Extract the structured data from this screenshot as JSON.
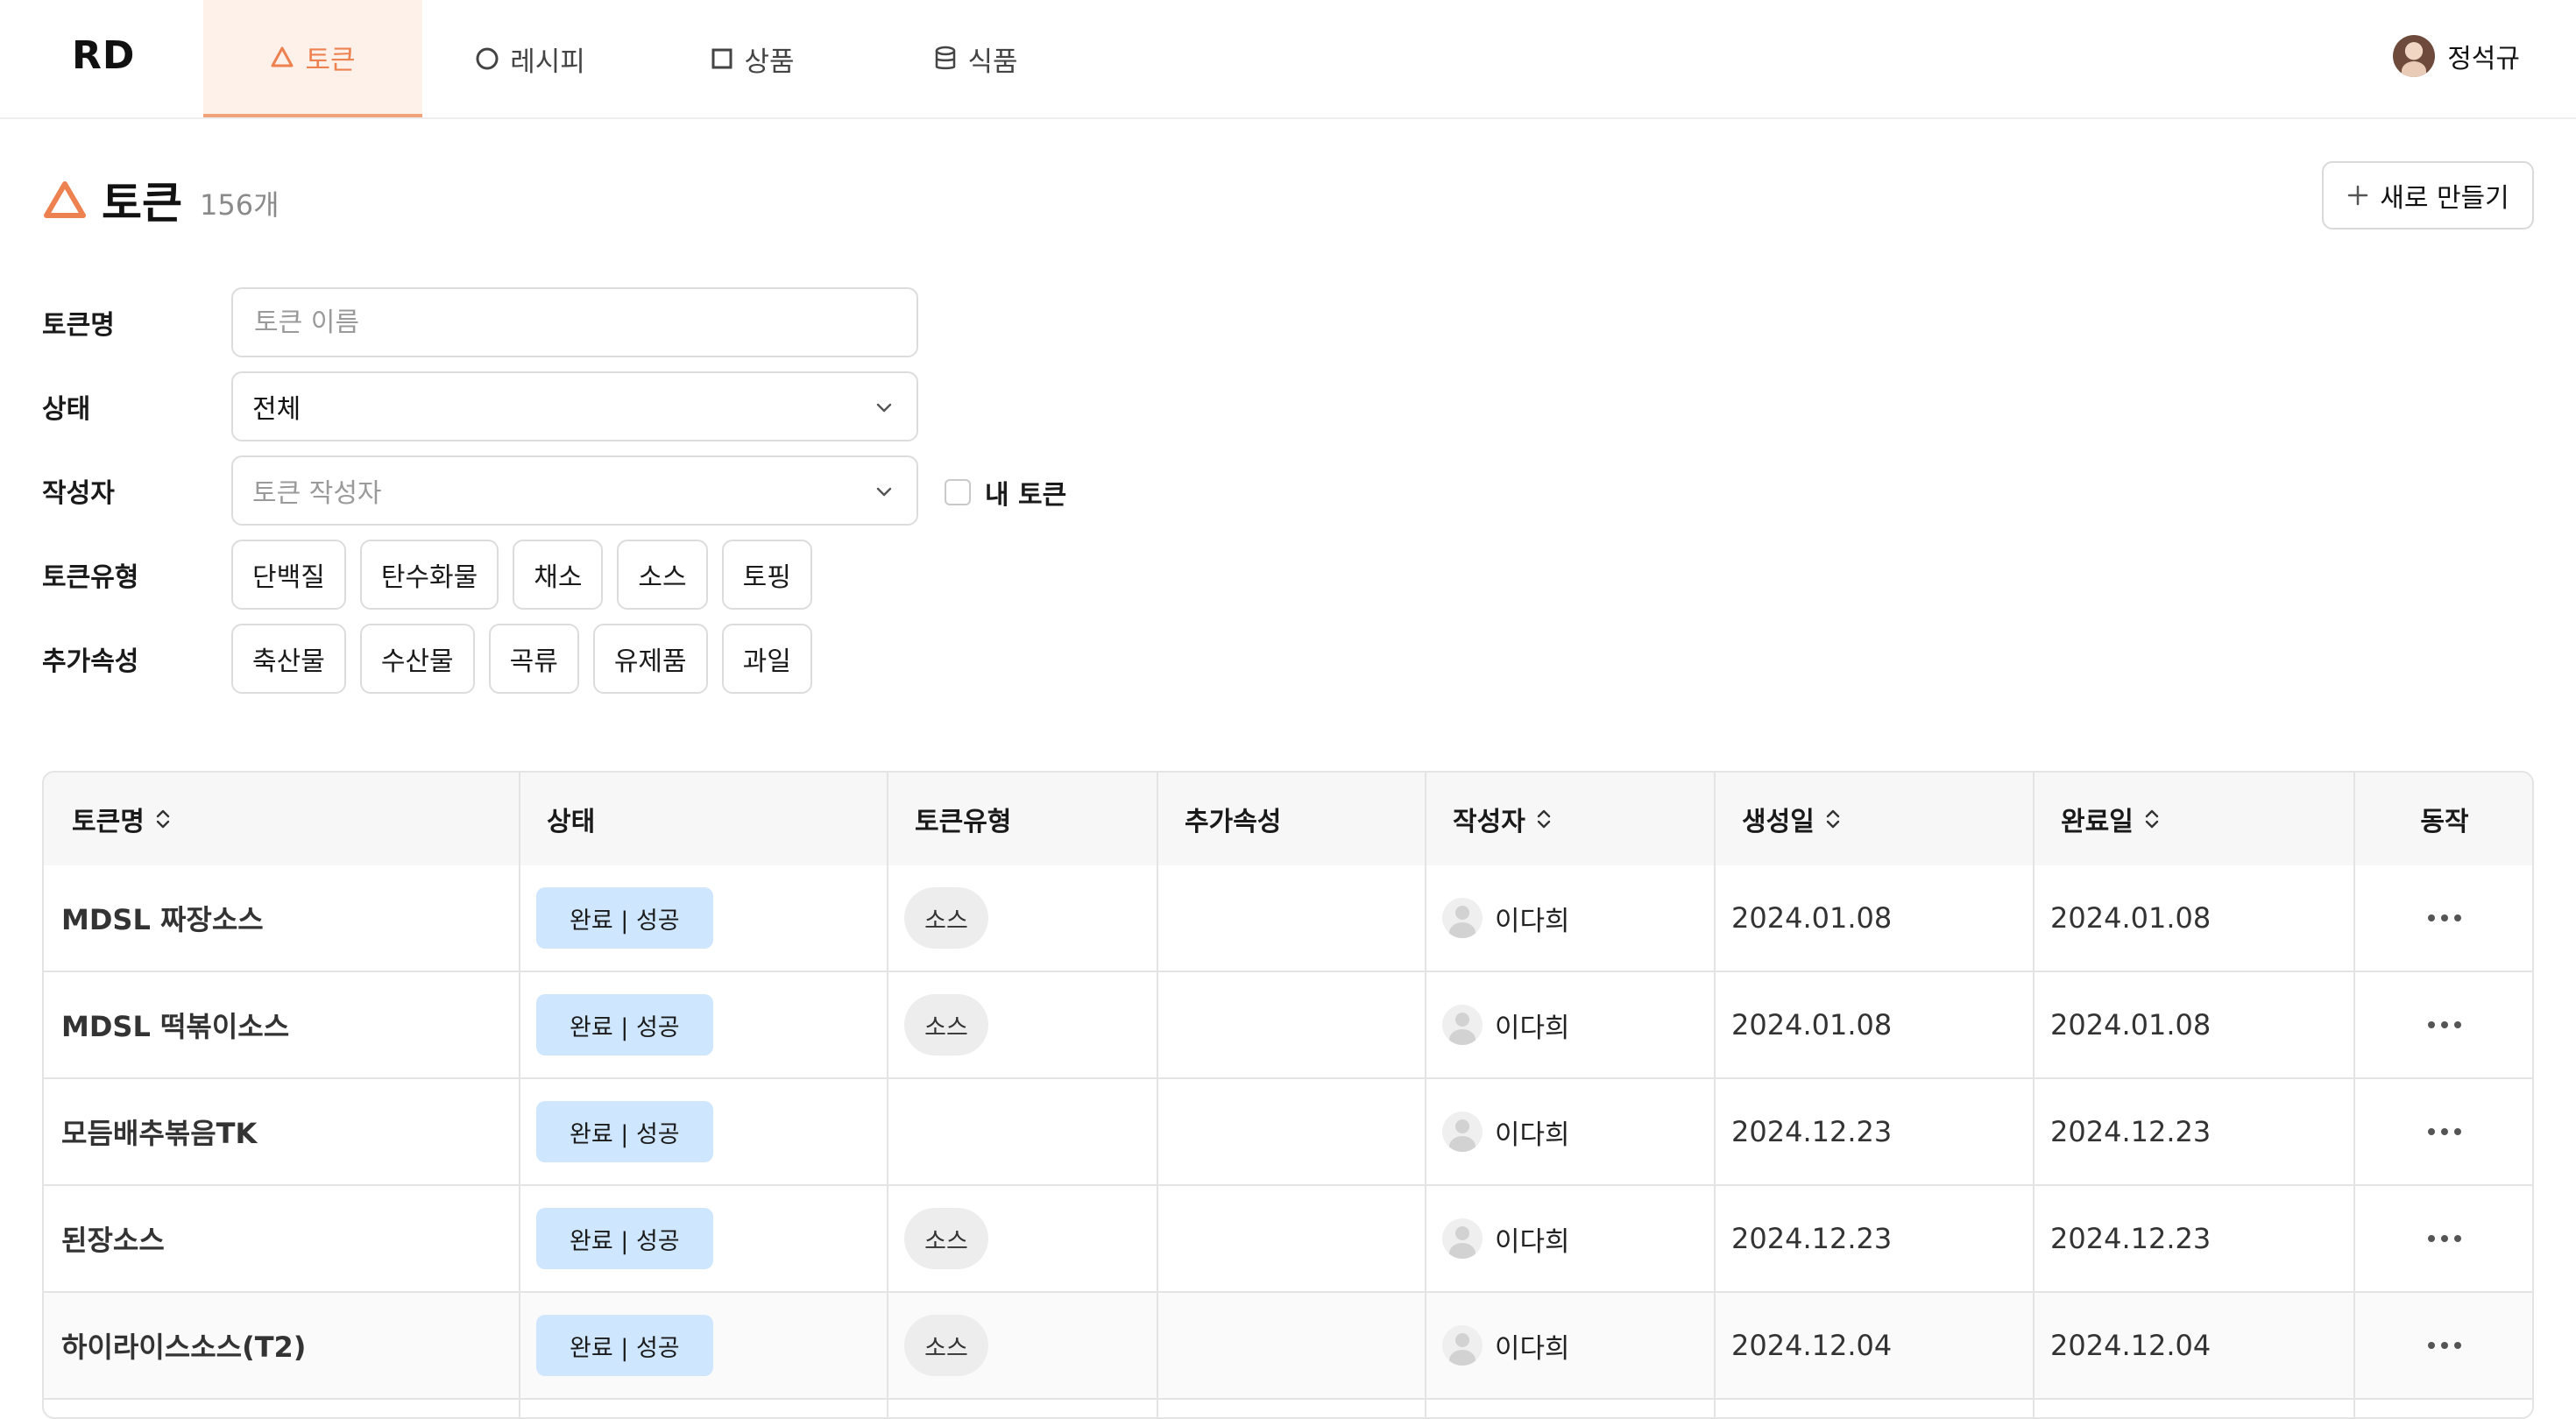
{
  "app": {
    "logo": "RD"
  },
  "nav": {
    "tabs": [
      {
        "label": "토큰",
        "icon": "triangle-icon",
        "active": true
      },
      {
        "label": "레시피",
        "icon": "circle-icon",
        "active": false
      },
      {
        "label": "상품",
        "icon": "square-icon",
        "active": false
      },
      {
        "label": "식품",
        "icon": "database-icon",
        "active": false
      }
    ]
  },
  "user": {
    "name": "정석규"
  },
  "page": {
    "title": "토큰",
    "count": "156개",
    "new_button": "새로 만들기",
    "accent": "#ee8150"
  },
  "filters": {
    "name": {
      "label": "토큰명",
      "placeholder": "토큰 이름",
      "value": ""
    },
    "status": {
      "label": "상태",
      "value": "전체"
    },
    "author": {
      "label": "작성자",
      "placeholder": "토큰 작성자"
    },
    "my_token": {
      "label": "내 토큰",
      "checked": false
    },
    "type": {
      "label": "토큰유형",
      "options": [
        "단백질",
        "탄수화물",
        "채소",
        "소스",
        "토핑"
      ]
    },
    "extra": {
      "label": "추가속성",
      "options": [
        "축산물",
        "수산물",
        "곡류",
        "유제품",
        "과일"
      ]
    }
  },
  "table": {
    "headers": {
      "name": "토큰명",
      "status": "상태",
      "type": "토큰유형",
      "extra": "추가속성",
      "author": "작성자",
      "created": "생성일",
      "completed": "완료일",
      "action": "동작"
    },
    "rows": [
      {
        "name": "MDSL 짜장소스",
        "status": "완료 | 성공",
        "type": "소스",
        "extra": "",
        "author": "이다희",
        "created": "2024.01.08",
        "completed": "2024.01.08"
      },
      {
        "name": "MDSL 떡볶이소스",
        "status": "완료 | 성공",
        "type": "소스",
        "extra": "",
        "author": "이다희",
        "created": "2024.01.08",
        "completed": "2024.01.08"
      },
      {
        "name": "모듬배추볶음TK",
        "status": "완료 | 성공",
        "type": "",
        "extra": "",
        "author": "이다희",
        "created": "2024.12.23",
        "completed": "2024.12.23"
      },
      {
        "name": "된장소스",
        "status": "완료 | 성공",
        "type": "소스",
        "extra": "",
        "author": "이다희",
        "created": "2024.12.23",
        "completed": "2024.12.23"
      },
      {
        "name": "하이라이스소스(T2)",
        "status": "완료 | 성공",
        "type": "소스",
        "extra": "",
        "author": "이다희",
        "created": "2024.12.04",
        "completed": "2024.12.04"
      }
    ]
  }
}
